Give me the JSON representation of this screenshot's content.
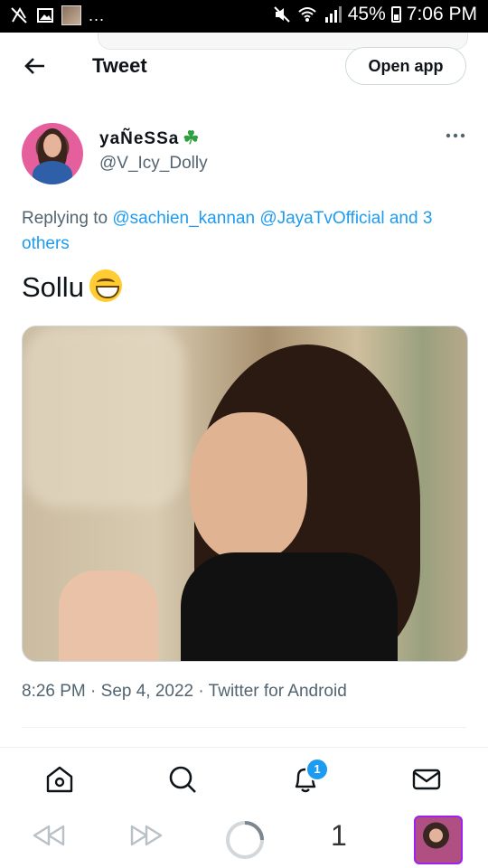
{
  "status_bar": {
    "left_icons": [
      "no-location-icon",
      "image-icon",
      "photo-thumbnail-icon"
    ],
    "overflow": "...",
    "right_icons": [
      "mute-icon",
      "wifi-icon",
      "signal-icon"
    ],
    "battery": "45%",
    "time": "7:06 PM"
  },
  "header": {
    "title": "Tweet",
    "open_app": "Open app"
  },
  "tweet": {
    "display_name": "yaÑeSSa",
    "name_emoji": "☘",
    "handle": "@V_Icy_Dolly",
    "replying_prefix": "Replying to",
    "mention_1": "@sachien_kannan",
    "mention_2": "@JayaTvOfficial",
    "and_others": "and 3 others",
    "text": "Sollu",
    "meta": "8:26 PM · Sep 4, 2022 · Twitter for Android"
  },
  "tab_bar": {
    "items": [
      "home-icon",
      "search-icon",
      "notifications-icon",
      "messages-icon"
    ],
    "notification_badge": "1"
  },
  "browser_bar": {
    "tab_count": "1"
  },
  "colors": {
    "accent": "#1d9bf0",
    "text": "#0f1419",
    "secondary": "#536471"
  }
}
